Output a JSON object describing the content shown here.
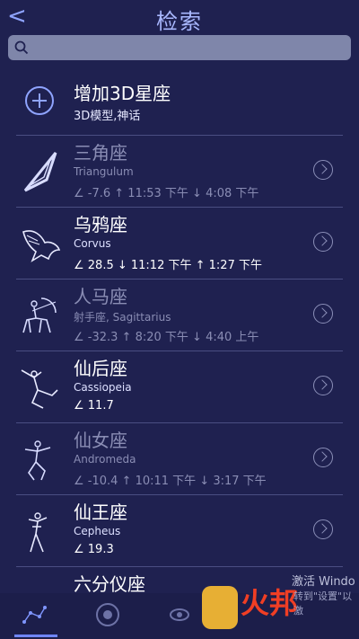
{
  "header": {
    "back_glyph": "<",
    "title": "检索"
  },
  "search": {
    "placeholder": ""
  },
  "add_item": {
    "title": "增加3D星座",
    "subtitle": "3D模型,神话"
  },
  "constellations": [
    {
      "name": "三角座",
      "sub": "Triangulum",
      "meta": "∠ -7.6 ↑ 11:53 下午 ↓ 4:08 下午",
      "dim": true
    },
    {
      "name": "乌鸦座",
      "sub": "Corvus",
      "meta": "∠ 28.5 ↓ 11:12 下午 ↑ 1:27 下午",
      "dim": false
    },
    {
      "name": "人马座",
      "sub": "射手座, Sagittarius",
      "meta": "∠ -32.3 ↑ 8:20 下午 ↓ 4:40 上午",
      "dim": true
    },
    {
      "name": "仙后座",
      "sub": "Cassiopeia",
      "meta": "∠ 11.7",
      "dim": false
    },
    {
      "name": "仙女座",
      "sub": "Andromeda",
      "meta": "∠ -10.4 ↑ 10:11 下午 ↓ 3:17 下午",
      "dim": true
    },
    {
      "name": "仙王座",
      "sub": "Cepheus",
      "meta": "∠ 19.3",
      "dim": false
    },
    {
      "name": "六分仪座",
      "sub": "",
      "meta": "",
      "dim": false
    }
  ],
  "tabs": [
    "constellation-tab",
    "planet-tab",
    "galaxy-tab"
  ],
  "watermark": {
    "line1": "激活 Windo",
    "line2": "转到\"设置\"以激"
  },
  "logo_text": "火邦"
}
